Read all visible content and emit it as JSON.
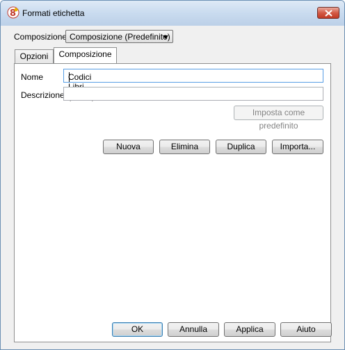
{
  "window": {
    "title": "Formati etichetta"
  },
  "composition_selector": {
    "label": "Composizione:",
    "selected": "Composizione (Predefinito)"
  },
  "tabs": [
    {
      "label": "Opzioni",
      "active": false
    },
    {
      "label": "Composizione",
      "active": true
    }
  ],
  "form": {
    "name_label": "Nome",
    "name_value": "Codici Libri (dorso)",
    "description_label": "Descrizione",
    "description_value": "",
    "set_default_button": "Imposta come predefinito"
  },
  "actions": {
    "new": "Nuova",
    "delete": "Elimina",
    "duplicate": "Duplica",
    "import": "Importa..."
  },
  "footer": {
    "ok": "OK",
    "cancel": "Annulla",
    "apply": "Applica",
    "help": "Aiuto"
  },
  "colors": {
    "titlebar": "#c9dbef",
    "close_button": "#c23a24",
    "focus_border": "#569de5"
  }
}
